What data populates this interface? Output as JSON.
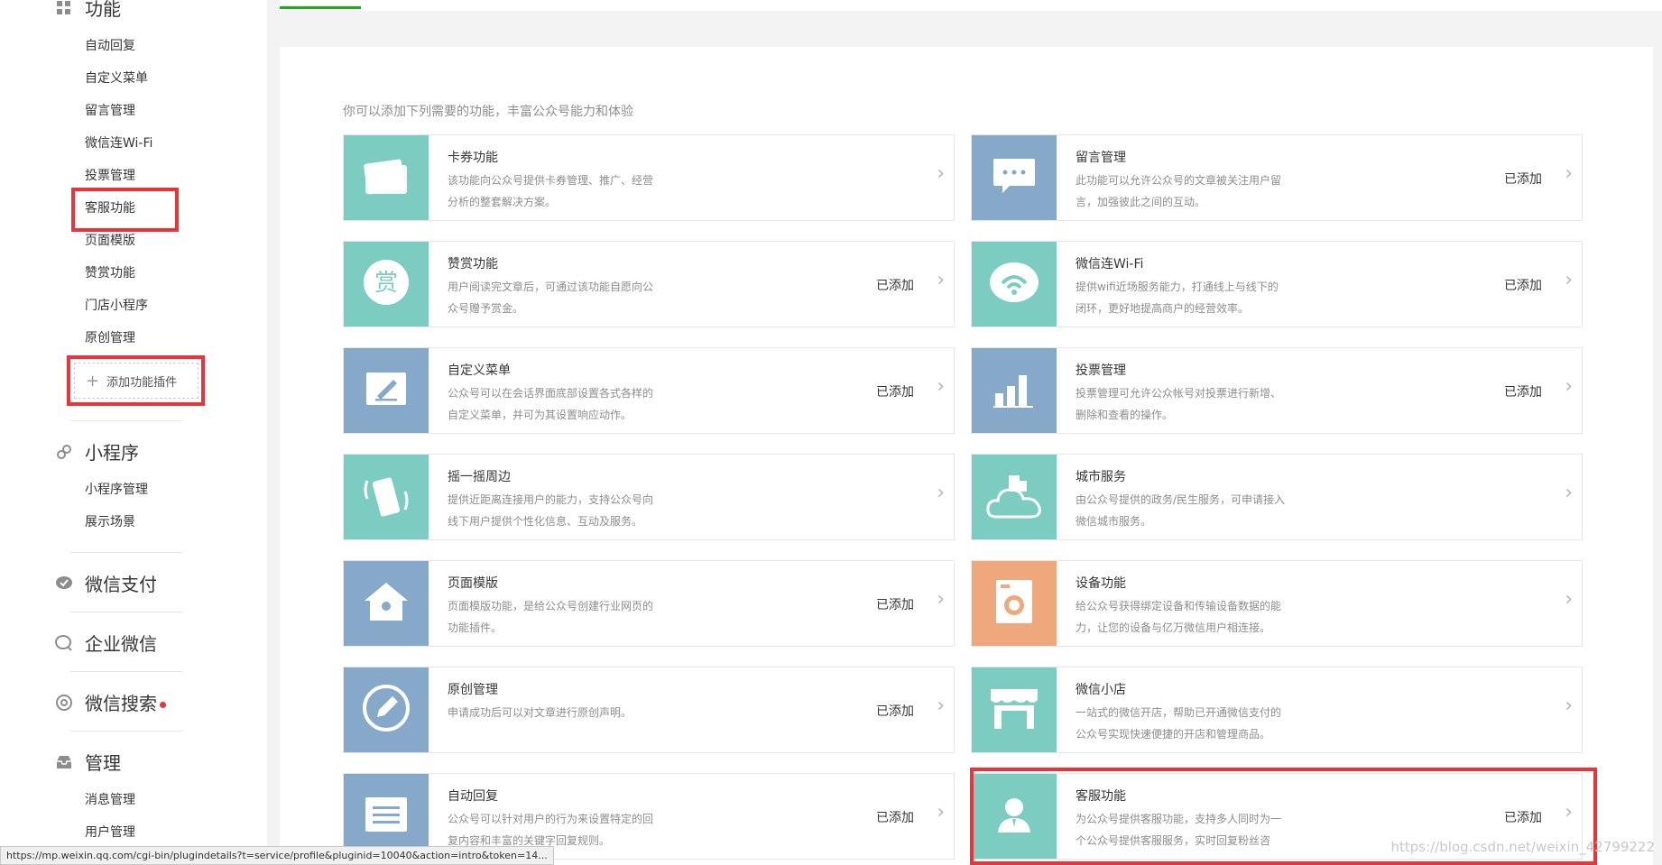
{
  "sidebar": {
    "groups": {
      "functions": {
        "title": "功能",
        "items": [
          "自动回复",
          "自定义菜单",
          "留言管理",
          "微信连Wi-Fi",
          "投票管理",
          "客服功能",
          "页面模版",
          "赞赏功能",
          "门店小程序",
          "原创管理"
        ],
        "add_plugin": "添加功能插件"
      },
      "miniprogram": {
        "title": "小程序",
        "items": [
          "小程序管理",
          "展示场景"
        ]
      },
      "pay": {
        "title": "微信支付"
      },
      "work": {
        "title": "企业微信"
      },
      "search": {
        "title": "微信搜索"
      },
      "manage": {
        "title": "管理",
        "items": [
          "消息管理",
          "用户管理"
        ]
      }
    }
  },
  "main": {
    "intro": "你可以添加下列需要的功能，丰富公众号能力和体验",
    "cards": [
      {
        "title": "卡券功能",
        "desc": "该功能向公众号提供卡券管理、推广、经营分析的整套解决方案。",
        "status": "",
        "color": "#7dccc1",
        "icon": "card-coupon-icon"
      },
      {
        "title": "留言管理",
        "desc": "此功能可以允许公众号的文章被关注用户留言，加强彼此之间的互动。",
        "status": "已添加",
        "color": "#86a9ca",
        "icon": "comment-icon"
      },
      {
        "title": "赞赏功能",
        "desc": "用户阅读完文章后，可通过该功能自愿向公众号赠予赏金。",
        "status": "已添加",
        "color": "#7dccc1",
        "icon": "reward-icon",
        "icon_text": "赏"
      },
      {
        "title": "微信连Wi-Fi",
        "desc": "提供wifi近场服务能力，打通线上与线下的闭环，更好地提高商户的经营效率。",
        "status": "已添加",
        "color": "#7dccc1",
        "icon": "wifi-icon"
      },
      {
        "title": "自定义菜单",
        "desc": "公众号可以在会话界面底部设置各式各样的自定义菜单，并可为其设置响应动作。",
        "status": "已添加",
        "color": "#86a9ca",
        "icon": "edit-menu-icon"
      },
      {
        "title": "投票管理",
        "desc": "投票管理可允许公众帐号对投票进行新增、删除和查看的操作。",
        "status": "已添加",
        "color": "#86a9ca",
        "icon": "bar-chart-icon"
      },
      {
        "title": "摇一摇周边",
        "desc": "提供近距离连接用户的能力，支持公众号向线下用户提供个性化信息、互动及服务。",
        "status": "",
        "color": "#7dccc1",
        "icon": "shake-phone-icon"
      },
      {
        "title": "城市服务",
        "desc": "由公众号提供的政务/民生服务，可申请接入微信城市服务。",
        "status": "",
        "color": "#7dccc1",
        "icon": "city-cloud-icon"
      },
      {
        "title": "页面模版",
        "desc": "页面模版功能，是给公众号创建行业网页的功能插件。",
        "status": "已添加",
        "color": "#86a9ca",
        "icon": "home-icon"
      },
      {
        "title": "设备功能",
        "desc": "给公众号获得绑定设备和传输设备数据的能力，让您的设备与亿万微信用户相连接。",
        "status": "",
        "color": "#eea87c",
        "icon": "device-icon"
      },
      {
        "title": "原创管理",
        "desc": "申请成功后可以对文章进行原创声明。",
        "status": "已添加",
        "color": "#86a9ca",
        "icon": "original-pen-icon"
      },
      {
        "title": "微信小店",
        "desc": "一站式的微信开店，帮助已开通微信支付的公众号实现快速便捷的开店和管理商品。",
        "status": "",
        "color": "#7dccc1",
        "icon": "shop-icon"
      },
      {
        "title": "自动回复",
        "desc": "公众号可以针对用户的行为来设置特定的回复内容和丰富的关键字回复规则。",
        "status": "已添加",
        "color": "#86a9ca",
        "icon": "auto-reply-icon"
      },
      {
        "title": "客服功能",
        "desc": "为公众号提供客服功能，支持多人同时为一个公众号提供客服服务，实时回复粉丝咨",
        "status": "已添加",
        "color": "#7dccc1",
        "icon": "customer-service-icon"
      }
    ]
  },
  "statusbar": {
    "url": "https://mp.weixin.qq.com/cgi-bin/plugindetails?t=service/profile&pluginid=10040&action=intro&token=14..."
  },
  "watermark": "https://blog.csdn.net/weixin_42799222"
}
